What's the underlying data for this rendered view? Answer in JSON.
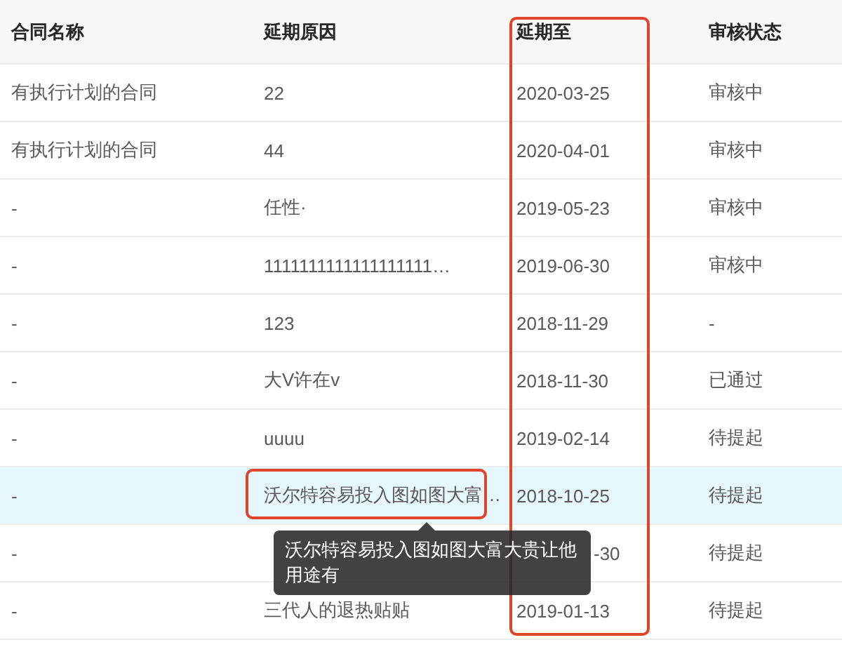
{
  "table": {
    "columns": [
      "合同名称",
      "延期原因",
      "延期至",
      "审核状态"
    ],
    "rows": [
      {
        "name": "有执行计划的合同",
        "reason": "22",
        "date": "2020-03-25",
        "status": "审核中",
        "hovered": false
      },
      {
        "name": "有执行计划的合同",
        "reason": "44",
        "date": "2020-04-01",
        "status": "审核中",
        "hovered": false
      },
      {
        "name": "-",
        "reason": "任性·",
        "date": "2019-05-23",
        "status": "审核中",
        "hovered": false
      },
      {
        "name": "-",
        "reason": "1111111111111111111…",
        "date": "2019-06-30",
        "status": "审核中",
        "hovered": false
      },
      {
        "name": "-",
        "reason": "123",
        "date": "2018-11-29",
        "status": "-",
        "hovered": false
      },
      {
        "name": "-",
        "reason": "大V许在v",
        "date": "2018-11-30",
        "status": "已通过",
        "hovered": false
      },
      {
        "name": "-",
        "reason": "uuuu",
        "date": "2019-02-14",
        "status": "待提起",
        "hovered": false
      },
      {
        "name": "-",
        "reason": "沃尔特容易投入图如图大富…",
        "date": "2018-10-25",
        "status": "待提起",
        "hovered": true
      },
      {
        "name": "-",
        "date": "-30",
        "status": "待提起",
        "hovered": false,
        "covered": true
      },
      {
        "name": "-",
        "reason": "三代人的退热贴贴",
        "date": "2019-01-13",
        "status": "待提起",
        "hovered": false
      }
    ]
  },
  "tooltip": {
    "text": "沃尔特容易投入图如图大富大贵让他用途有"
  }
}
